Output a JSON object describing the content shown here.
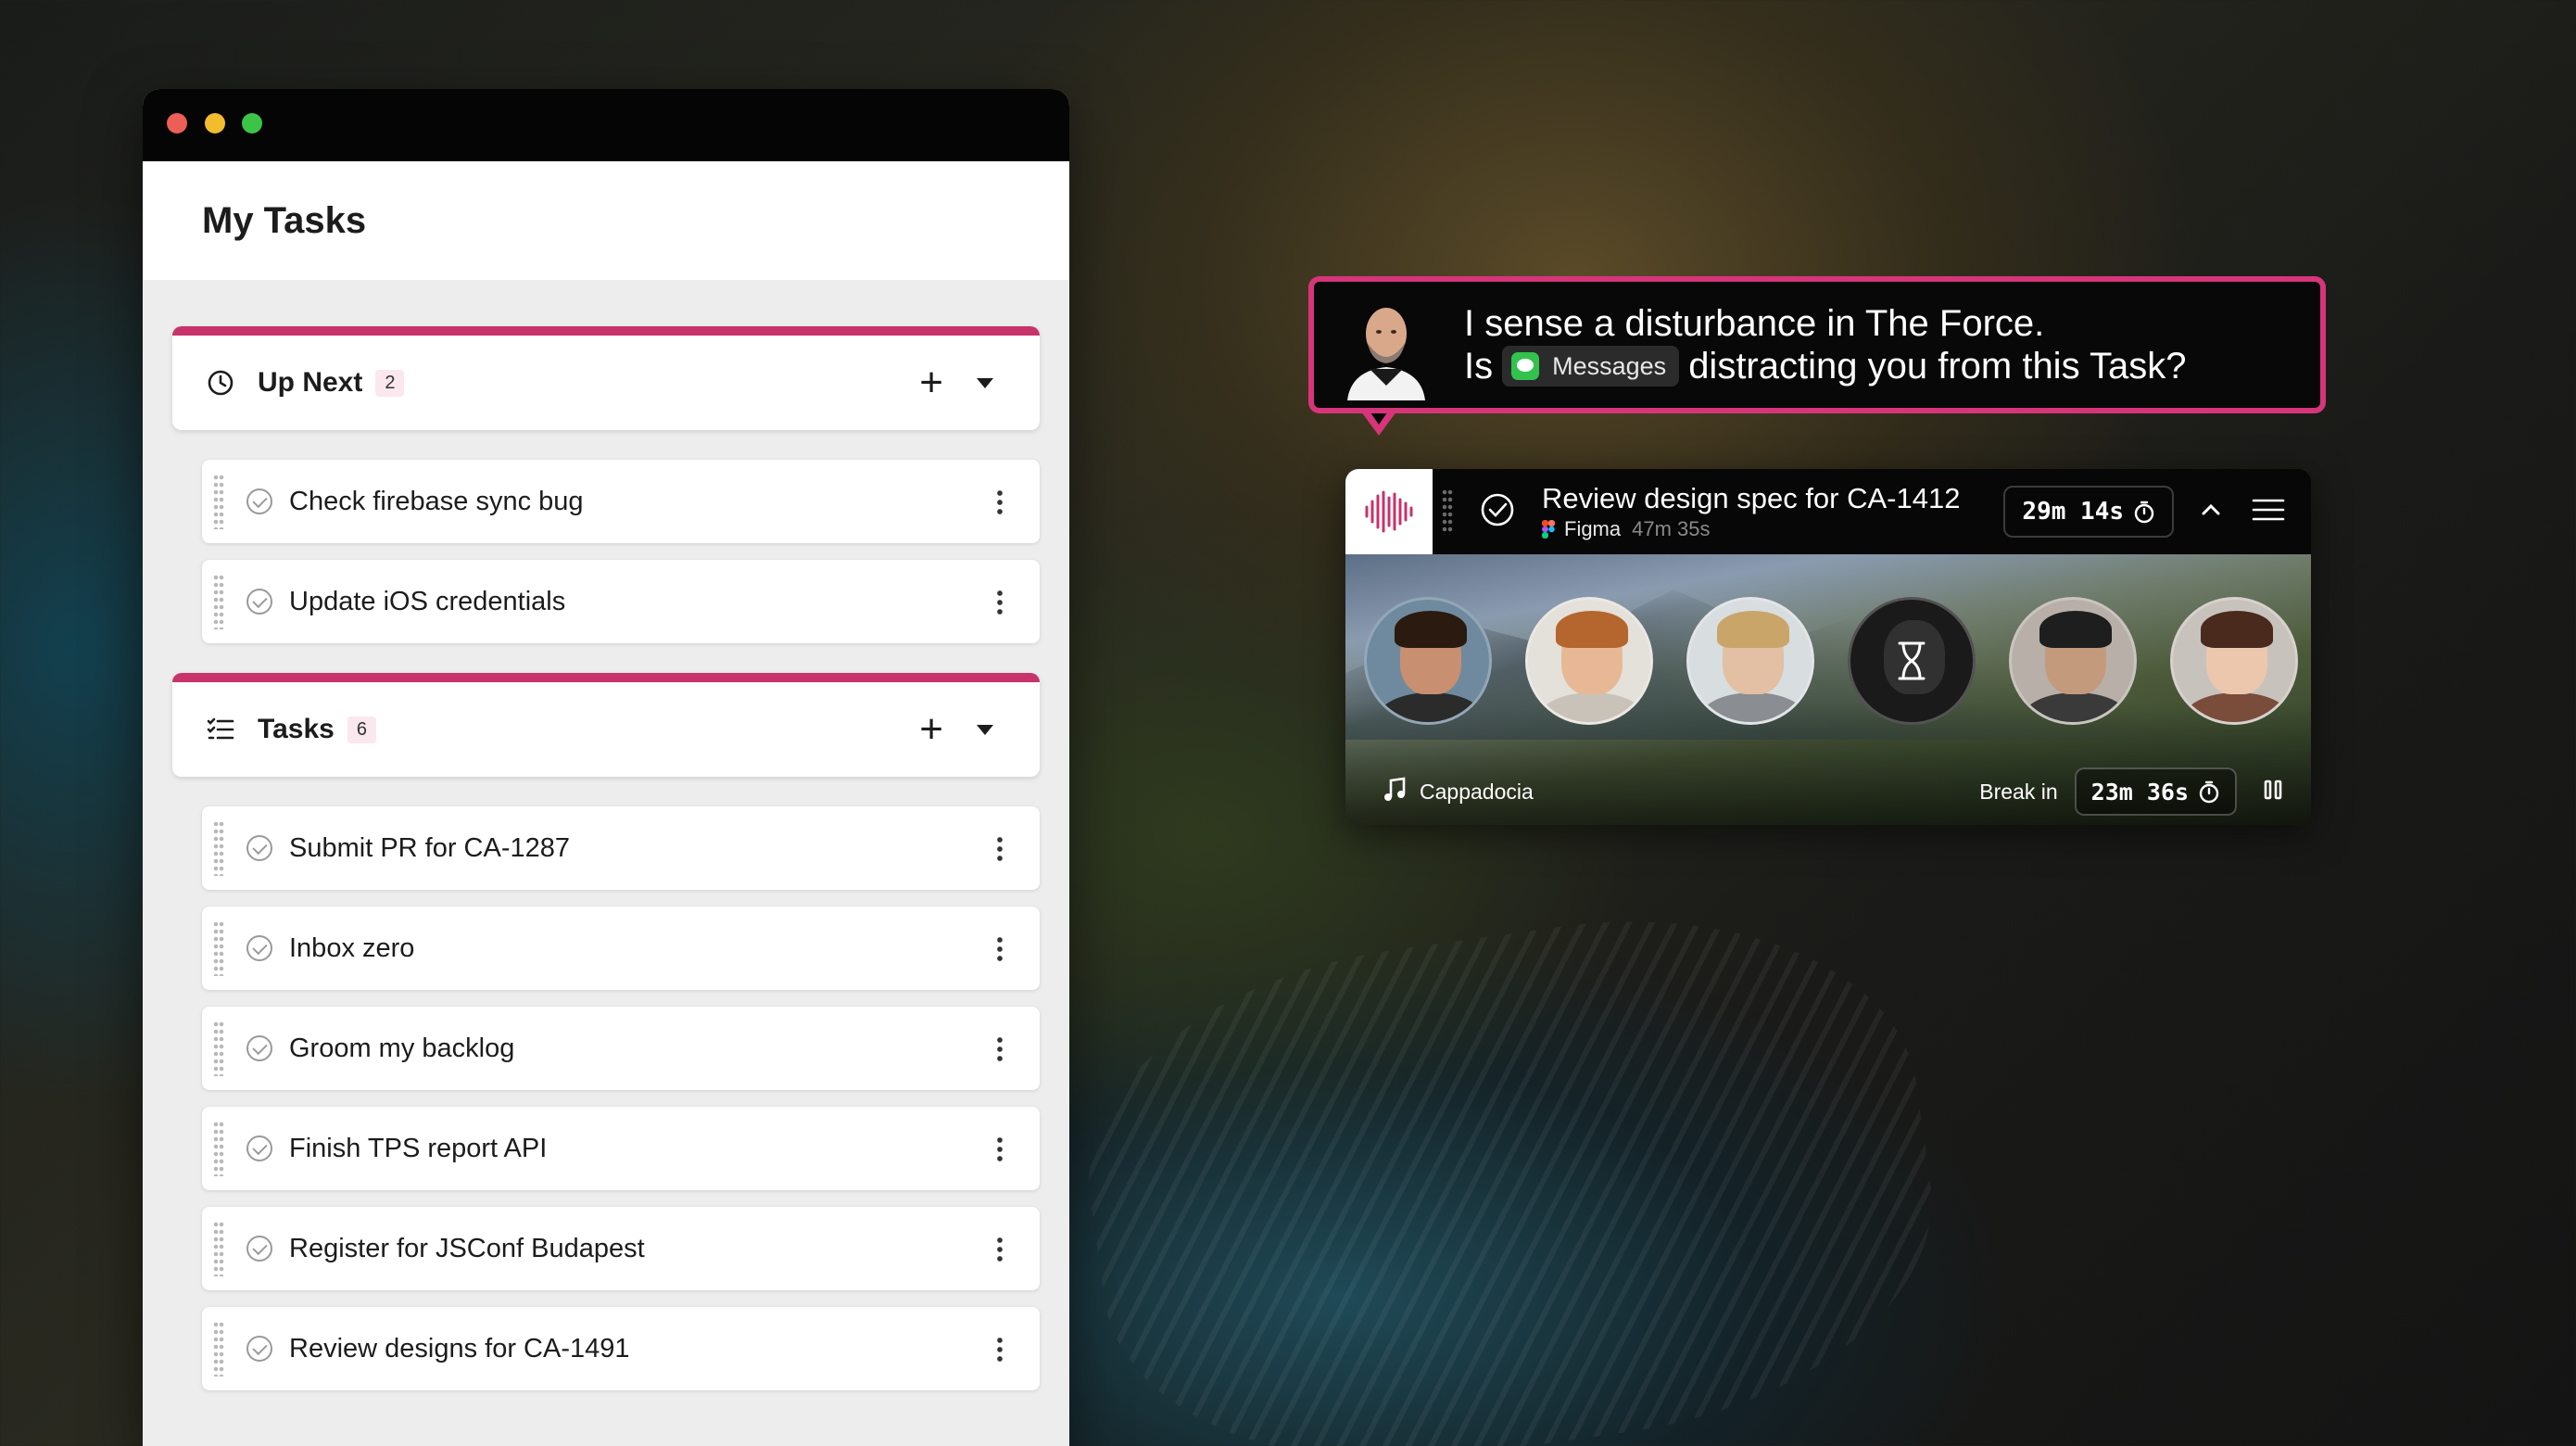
{
  "window": {
    "title": "My Tasks"
  },
  "sections": [
    {
      "label": "Up Next",
      "count": "2",
      "icon": "clock-icon",
      "tasks": [
        "Check firebase sync bug",
        "Update iOS credentials"
      ]
    },
    {
      "label": "Tasks",
      "count": "6",
      "icon": "checklist-icon",
      "tasks": [
        "Submit PR for CA-1287",
        "Inbox zero",
        "Groom my backlog",
        "Finish TPS report API",
        "Register for JSConf Budapest",
        "Review designs for CA-1491"
      ]
    }
  ],
  "bubble": {
    "line1": "I sense a disturbance in The Force.",
    "line2_prefix": "Is",
    "app_name": "Messages",
    "line2_suffix": "distracting you from this Task?"
  },
  "widget": {
    "task_title": "Review design spec for CA-1412",
    "app": "Figma",
    "app_time": "47m 35s",
    "timer": "29m 14s",
    "track": "Cappadocia",
    "break_label": "Break in",
    "break_timer": "23m 36s"
  },
  "colors": {
    "accent": "#c7336a",
    "bubble_border": "#d6357a",
    "messages_green": "#32c24d"
  }
}
